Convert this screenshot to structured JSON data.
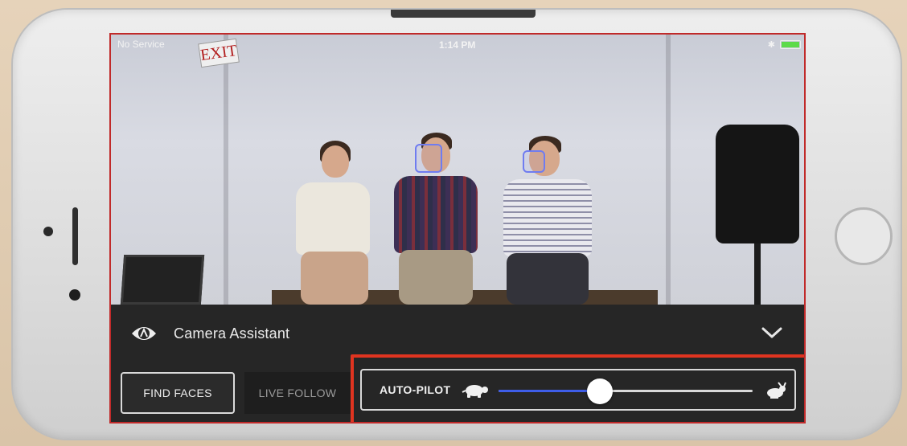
{
  "status_bar": {
    "carrier": "No Service",
    "time": "1:14 PM"
  },
  "scene": {
    "exit_sign": "EXIT"
  },
  "panel": {
    "title": "Camera Assistant",
    "find_faces_label": "FIND FACES",
    "live_follow_label": "LIVE FOLLOW",
    "autopilot": {
      "label": "AUTO-PILOT",
      "speed_fraction": 0.4,
      "slow_icon": "turtle-icon",
      "fast_icon": "rabbit-icon"
    }
  },
  "colors": {
    "highlight": "#e03420",
    "slider_fill": "#3e5de8",
    "face_box": "#6f7cf0",
    "battery": "#5ddb4a"
  }
}
